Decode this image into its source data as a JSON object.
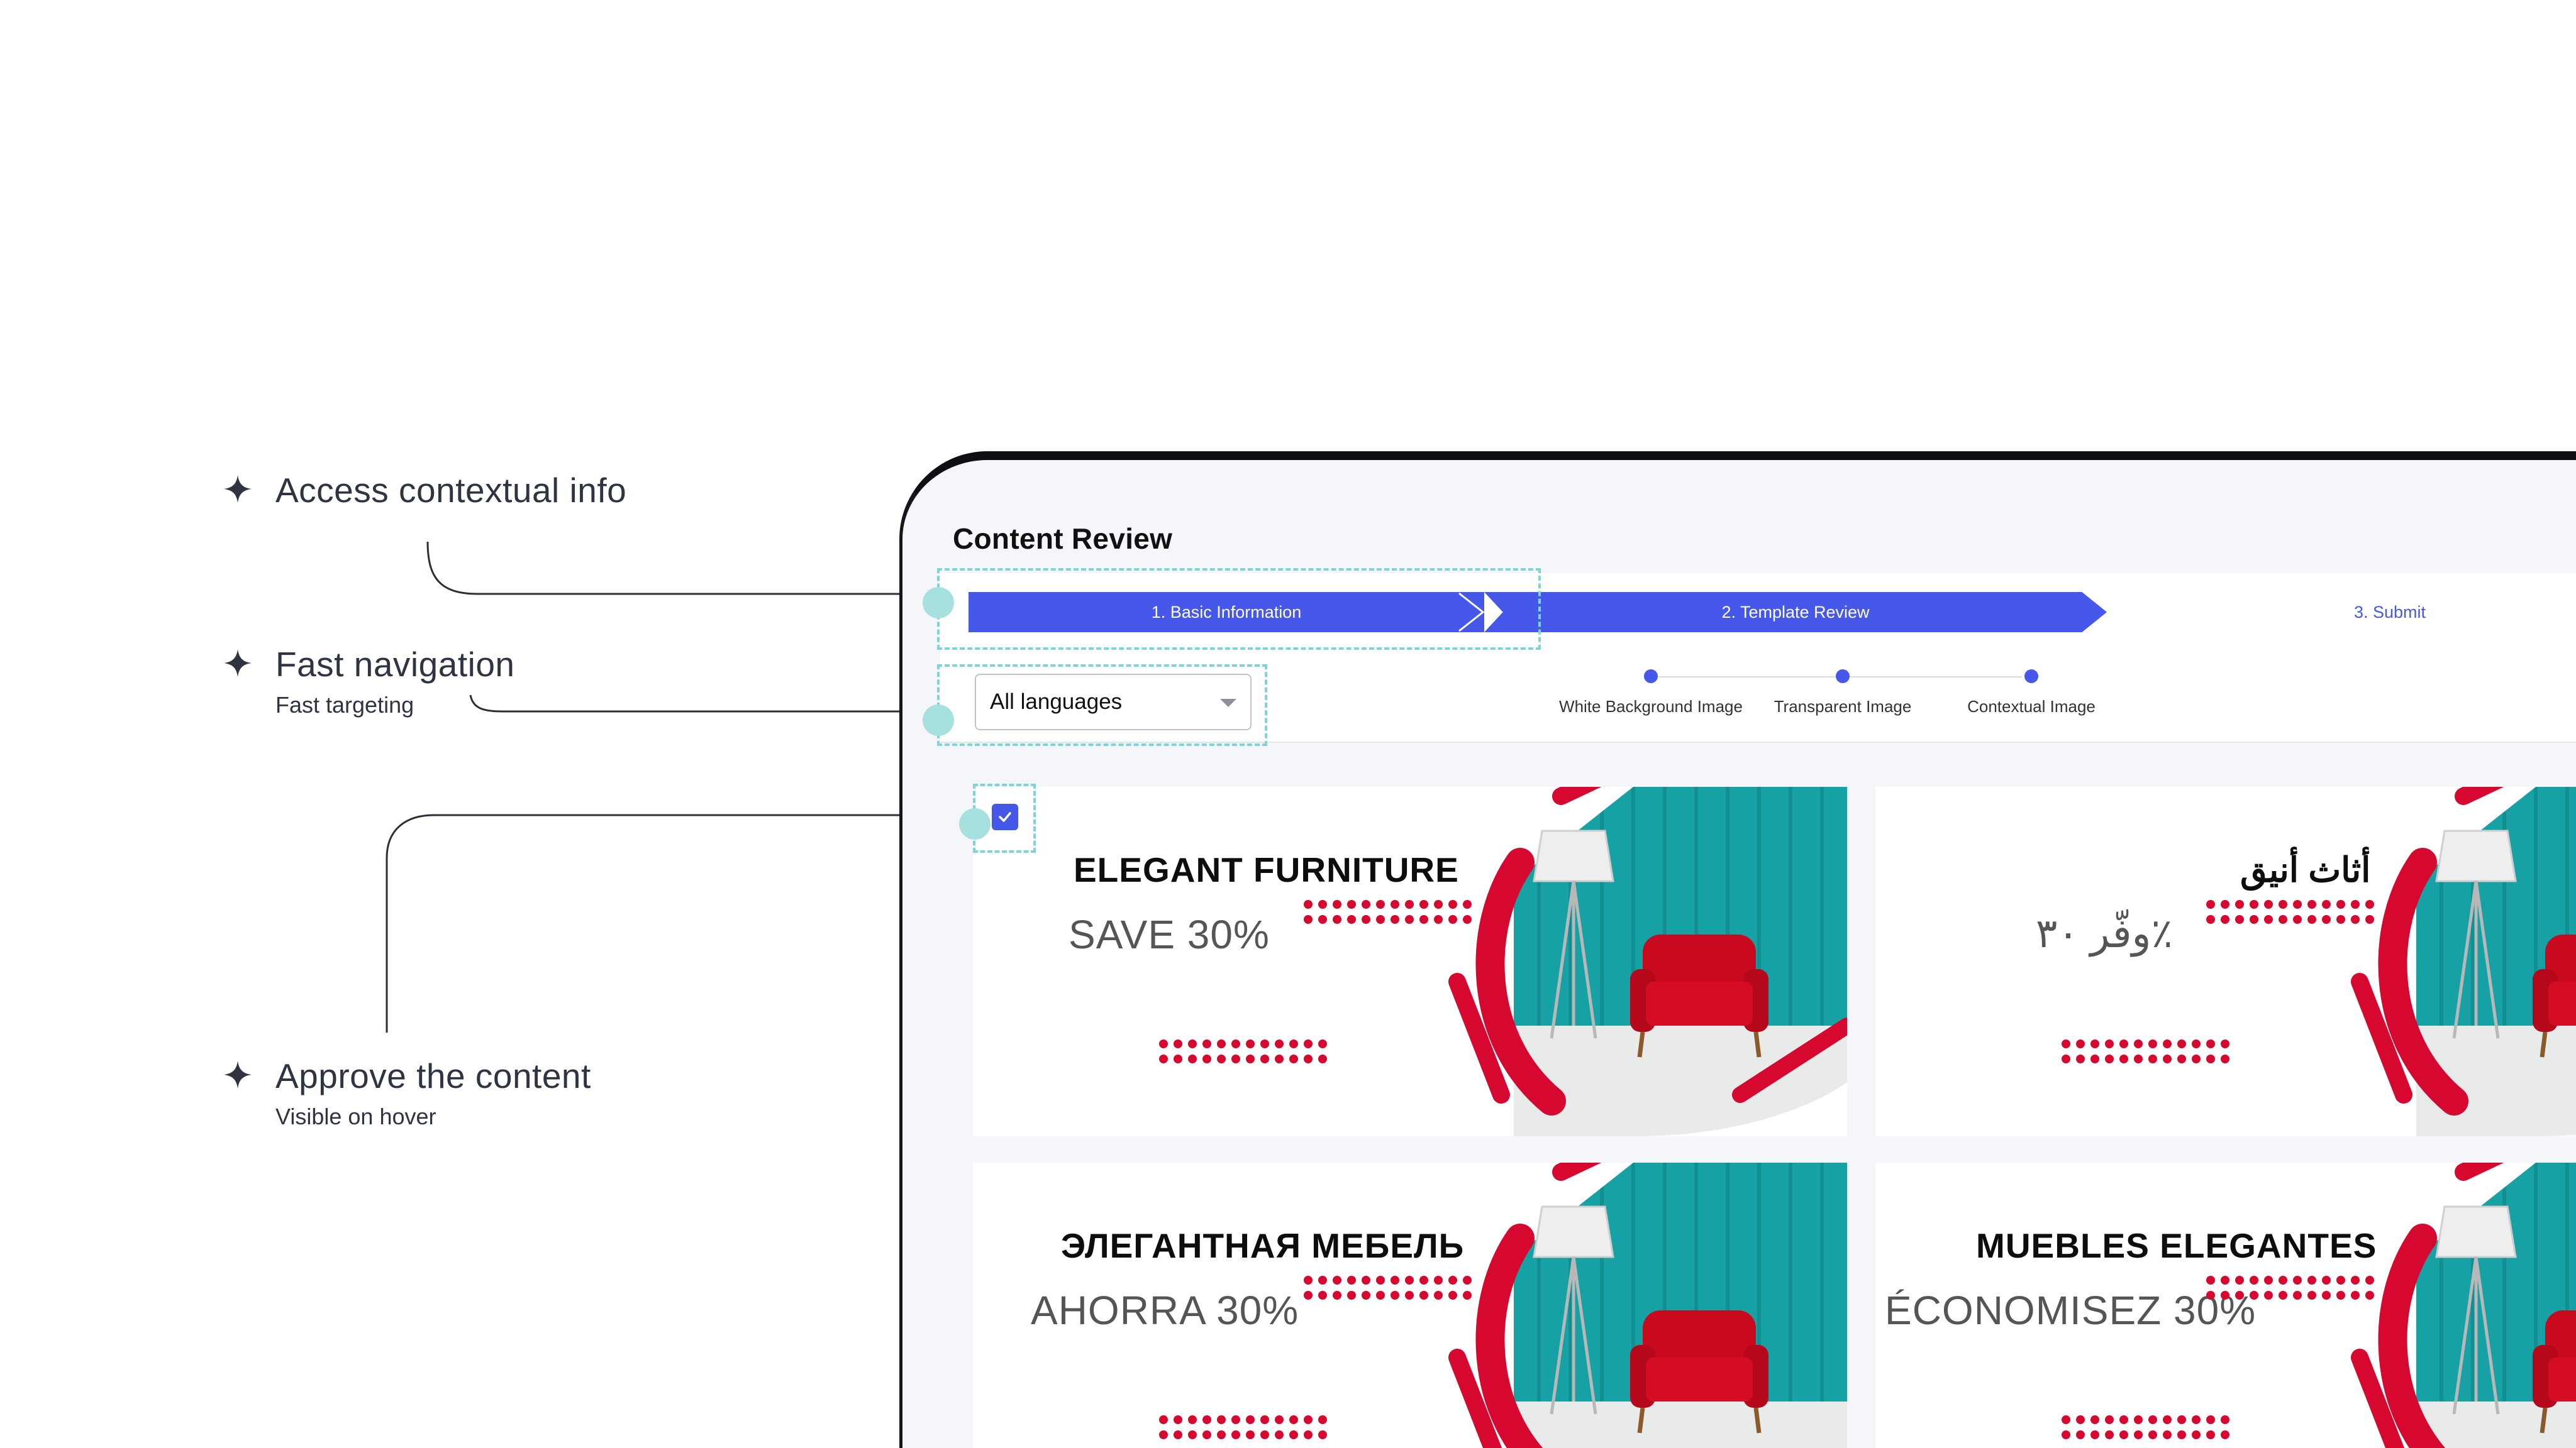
{
  "annotations": [
    {
      "title": "Access contextual info",
      "subtitle": ""
    },
    {
      "title": "Fast navigation",
      "subtitle": "Fast targeting"
    },
    {
      "title": "Approve the content",
      "subtitle": "Visible on hover"
    }
  ],
  "page": {
    "title": "Content Review"
  },
  "stepper": {
    "steps": [
      {
        "label": "1. Basic Information",
        "state": "done"
      },
      {
        "label": "2. Template Review",
        "state": "active"
      },
      {
        "label": "3. Submit",
        "state": "upcoming"
      }
    ],
    "substeps": [
      {
        "label": "White Background Image"
      },
      {
        "label": "Transparent Image"
      },
      {
        "label": "Contextual Image"
      }
    ]
  },
  "filters": {
    "language_select": {
      "value": "All languages"
    }
  },
  "cards": [
    {
      "headline": "ELEGANT FURNITURE",
      "offer": "SAVE 30%",
      "checked": true
    },
    {
      "headline": "أثاث أنيق",
      "offer": "وفّر ٣٠٪",
      "checked": false
    },
    {
      "headline": "ЭЛЕГАНТНАЯ МЕБЕЛЬ",
      "offer": "AHORRA 30%",
      "checked": false
    },
    {
      "headline": "MUEBLES ELEGANTES",
      "offer": "ÉCONOMISEZ 30%",
      "checked": false
    }
  ],
  "colors": {
    "accent": "#4558ea",
    "highlight": "#7ed6d4",
    "banner_red": "#d6082f",
    "banner_teal": "#16a2a5"
  },
  "icons": {
    "annotation_marker": "sparkle-icon",
    "select_caret": "chevron-down-icon",
    "checkbox": "check-icon"
  }
}
